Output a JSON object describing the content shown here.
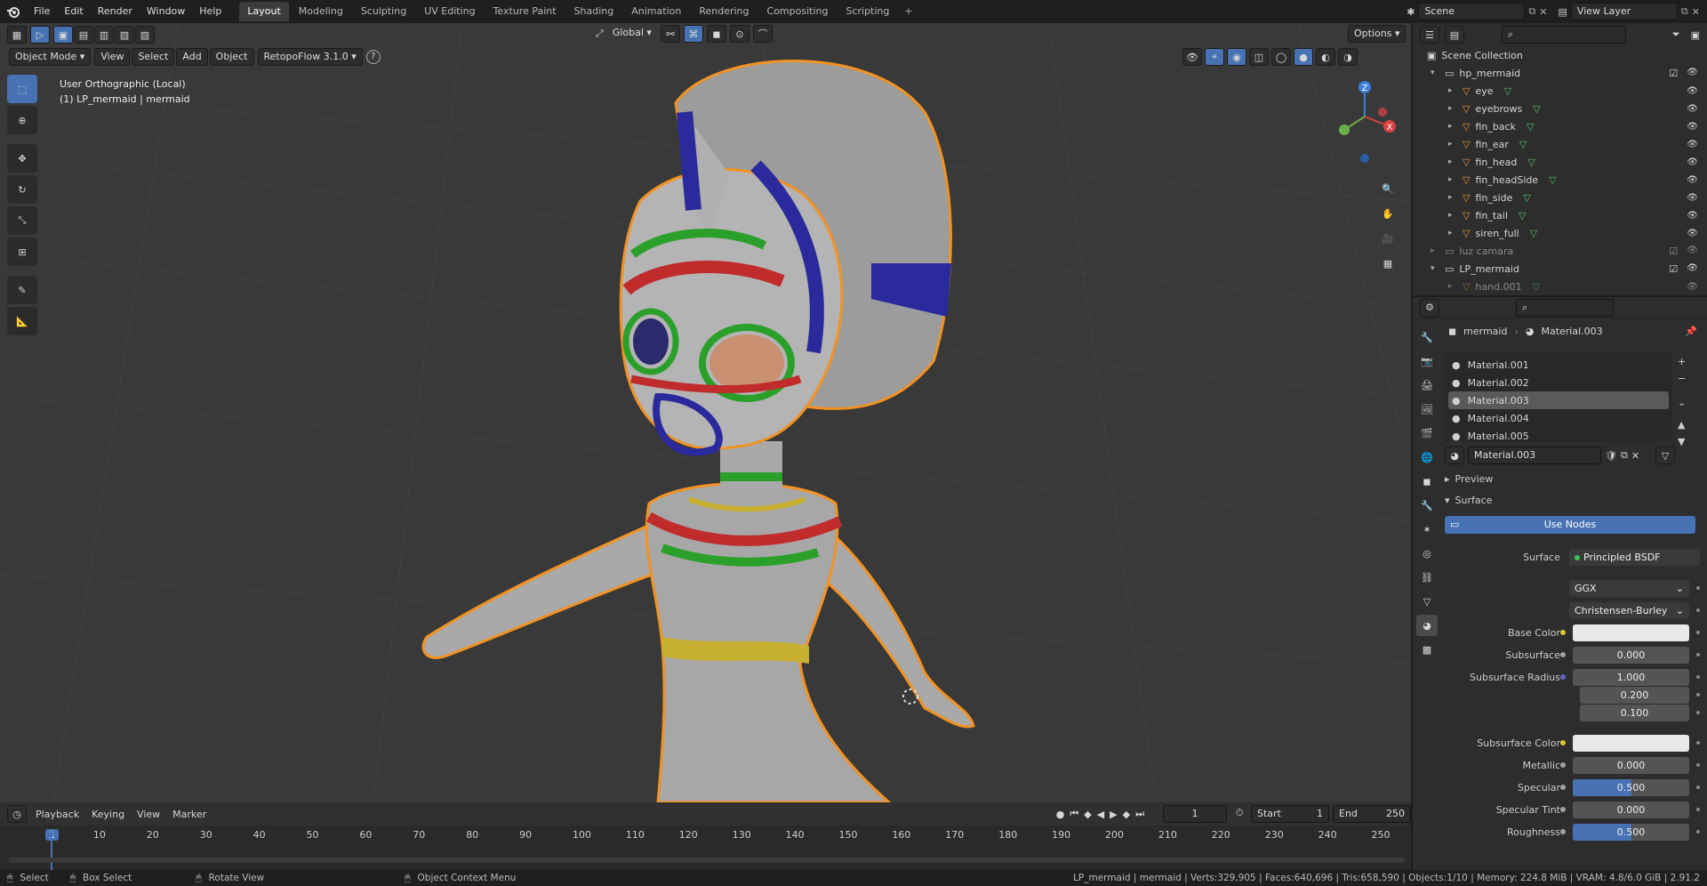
{
  "topbar": {
    "menus": [
      "File",
      "Edit",
      "Render",
      "Window",
      "Help"
    ],
    "workspace_tabs": [
      "Layout",
      "Modeling",
      "Sculpting",
      "UV Editing",
      "Texture Paint",
      "Shading",
      "Animation",
      "Rendering",
      "Compositing",
      "Scripting"
    ],
    "active_tab": "Layout",
    "scene": "Scene",
    "view_layer": "View Layer"
  },
  "viewport": {
    "mode": "Object Mode",
    "menus": [
      "View",
      "Select",
      "Add",
      "Object"
    ],
    "addon": "RetopoFlow 3.1.0",
    "help": "?",
    "transform_orientation": "Global",
    "options_label": "Options",
    "view_name": "User Orthographic (Local)",
    "object_info": "(1) LP_mermaid | mermaid",
    "gizmo_axes": {
      "z": "Z",
      "x": "X",
      "y": "Y"
    }
  },
  "outliner": {
    "root": "Scene Collection",
    "items": [
      {
        "name": "hp_mermaid",
        "kind": "collection",
        "depth": 0,
        "expanded": true
      },
      {
        "name": "eye",
        "kind": "object",
        "depth": 1
      },
      {
        "name": "eyebrows",
        "kind": "object",
        "depth": 1
      },
      {
        "name": "fin_back",
        "kind": "object",
        "depth": 1
      },
      {
        "name": "fin_ear",
        "kind": "object",
        "depth": 1
      },
      {
        "name": "fin_head",
        "kind": "object",
        "depth": 1
      },
      {
        "name": "fin_headSide",
        "kind": "object",
        "depth": 1
      },
      {
        "name": "fin_side",
        "kind": "object",
        "depth": 1
      },
      {
        "name": "fin_tail",
        "kind": "object",
        "depth": 1
      },
      {
        "name": "siren_full",
        "kind": "object",
        "depth": 1
      },
      {
        "name": "luz camara",
        "kind": "collection",
        "depth": 0,
        "expanded": false,
        "dim": true
      },
      {
        "name": "LP_mermaid",
        "kind": "collection",
        "depth": 0,
        "expanded": true
      },
      {
        "name": "hand.001",
        "kind": "object",
        "depth": 1,
        "dim": true
      }
    ]
  },
  "properties": {
    "object": "mermaid",
    "material": "Material.003",
    "slots": [
      "Material.001",
      "Material.002",
      "Material.003",
      "Material.004",
      "Material.005"
    ],
    "active_slot": "Material.003",
    "datablock": "Material.003",
    "preview_label": "Preview",
    "surface_section": "Surface",
    "use_nodes": "Use Nodes",
    "surface_label": "Surface",
    "surface_shader": "Principled BSDF",
    "distribution": "GGX",
    "subsurface_method": "Christensen-Burley",
    "fields": {
      "base_color_label": "Base Color",
      "subsurface_label": "Subsurface",
      "subsurface_value": "0.000",
      "subsurface_radius_label": "Subsurface Radius",
      "radius_values": [
        "1.000",
        "0.200",
        "0.100"
      ],
      "subsurface_color_label": "Subsurface Color",
      "metallic_label": "Metallic",
      "metallic_value": "0.000",
      "specular_label": "Specular",
      "specular_value": "0.500",
      "specular_fill": 0.5,
      "specular_tint_label": "Specular Tint",
      "specular_tint_value": "0.000",
      "roughness_label": "Roughness",
      "roughness_value": "0.500",
      "roughness_fill": 0.5
    }
  },
  "timeline": {
    "menus": [
      "Playback",
      "Keying",
      "View",
      "Marker"
    ],
    "current_frame": "1",
    "start_label": "Start",
    "start": "1",
    "end_label": "End",
    "end": "250",
    "ruler_labels": [
      "1",
      "10",
      "20",
      "30",
      "40",
      "50",
      "60",
      "70",
      "80",
      "90",
      "100",
      "110",
      "120",
      "130",
      "140",
      "150",
      "160",
      "170",
      "180",
      "190",
      "200",
      "210",
      "220",
      "230",
      "240",
      "250"
    ]
  },
  "statusbar": {
    "select": "Select",
    "box_select": "Box Select",
    "rotate_view": "Rotate View",
    "context_menu": "Object Context Menu",
    "stats": "LP_mermaid | mermaid | Verts:329,905 | Faces:640,696 | Tris:658,590 | Objects:1/10 | Memory: 224.8 MiB | VRAM: 4.8/6.0 GiB | 2.91.2"
  },
  "colors": {
    "accent": "#4772b3",
    "selection_outline": "#f29222",
    "viewport_bg": "#393939",
    "panel_bg": "#2d2d2d"
  }
}
